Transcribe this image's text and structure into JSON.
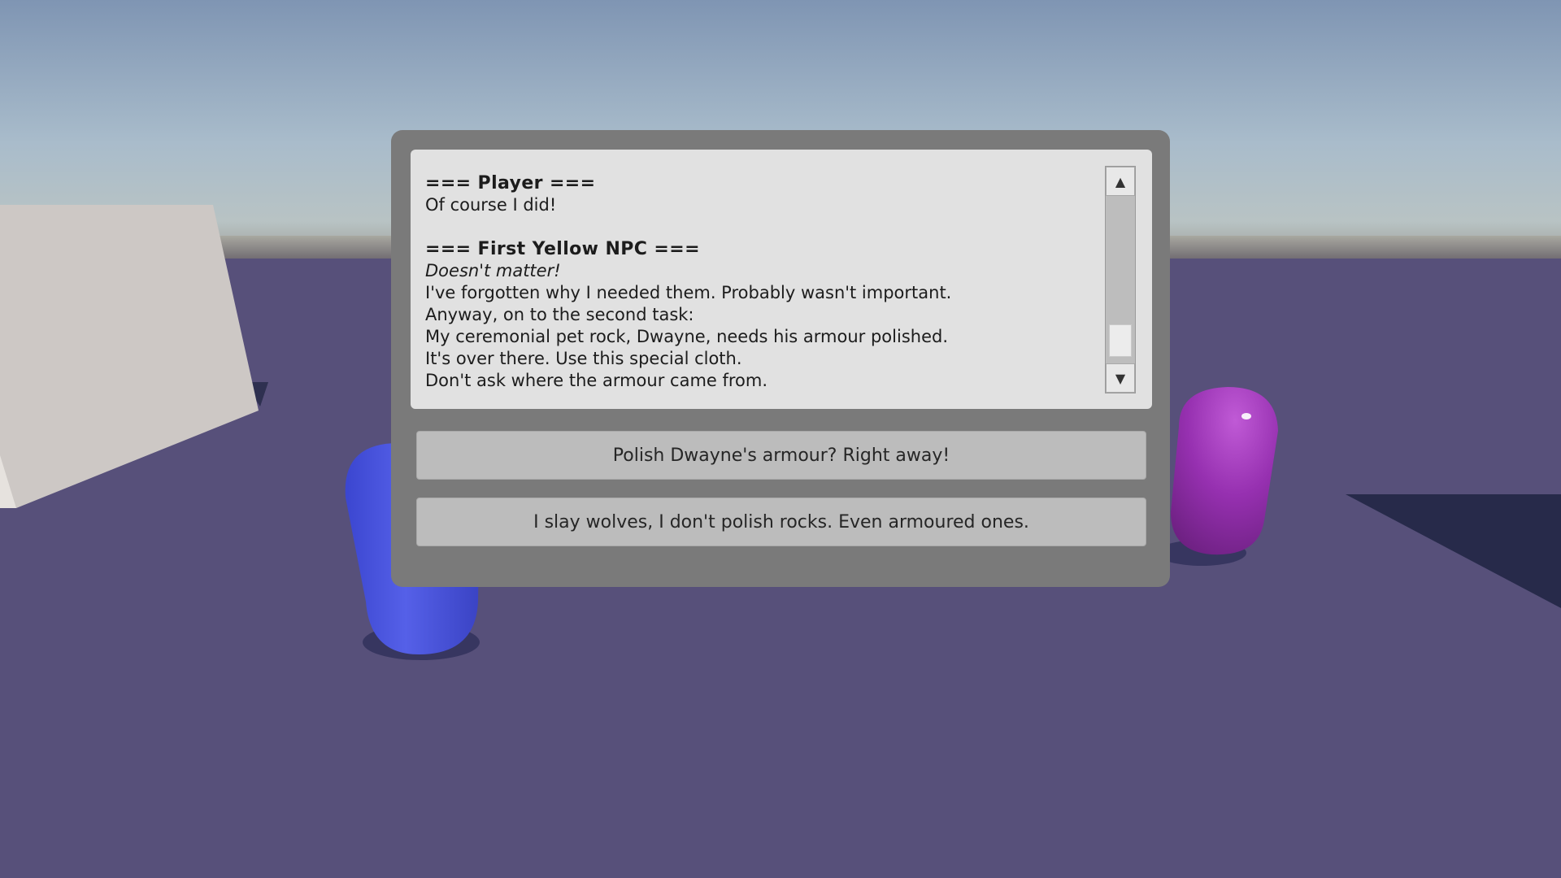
{
  "transcript": {
    "entries": [
      {
        "speaker": "=== Player ===",
        "lines": [
          "Of course I did!"
        ]
      },
      {
        "speaker": "=== First Yellow NPC ===",
        "emphasis": "Doesn't matter!",
        "lines": [
          "I've forgotten why I needed them. Probably wasn't important.",
          "Anyway, on to the second task:",
          "My ceremonial pet rock, Dwayne, needs his armour polished.",
          "It's over there. Use this special cloth.",
          "Don't ask where the armour came from."
        ]
      }
    ],
    "scroll_position": 0.95
  },
  "scrollbar": {
    "up_icon": "triangle-up-icon",
    "down_icon": "triangle-down-icon"
  },
  "choices": [
    {
      "label": "Polish Dwayne's armour? Right away!"
    },
    {
      "label": "I slay wolves, I don't polish rocks. Even armoured ones."
    }
  ],
  "colors": {
    "panel": "#7a7a7a",
    "transcript_bg": "#e1e1e1",
    "button_bg": "#bcbcbc",
    "ground": "#57507a",
    "sky_top": "#8096b4",
    "capsule_blue": "#4a55e0",
    "capsule_purple": "#9a33b4"
  }
}
